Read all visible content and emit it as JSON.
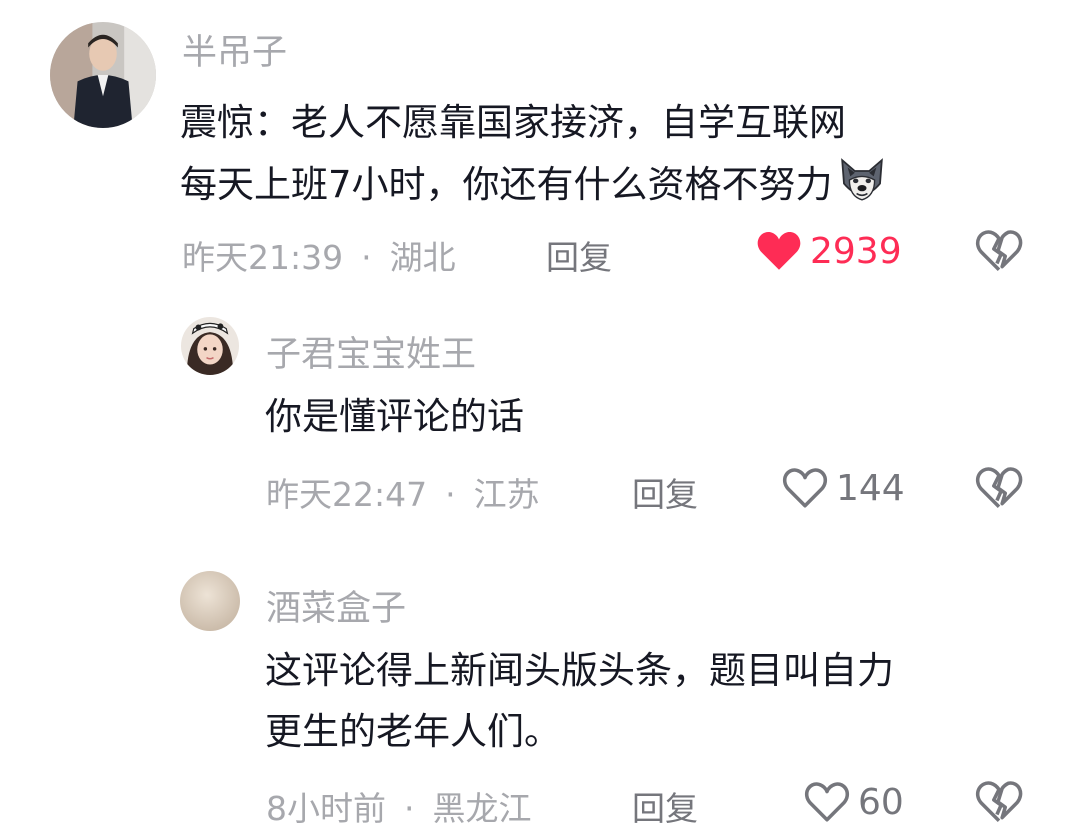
{
  "comments": [
    {
      "username": "半吊子",
      "text_lines": [
        "震惊：老人不愿靠国家接济，自学互联网",
        "每天上班7小时，你还有什么资格不努力"
      ],
      "emoji": "wolf-face-icon",
      "time": "昨天21:39",
      "separator": "·",
      "location": "湖北",
      "reply_label": "回复",
      "likes": "2939",
      "liked": true
    },
    {
      "username": "子君宝宝姓王",
      "text_lines": [
        "你是懂评论的话"
      ],
      "time": "昨天22:47",
      "separator": "·",
      "location": "江苏",
      "reply_label": "回复",
      "likes": "144",
      "liked": false
    },
    {
      "username": "酒菜盒子",
      "text_lines": [
        "这评论得上新闻头版头条，题目叫自力",
        "更生的老年人们。"
      ],
      "time": "8小时前",
      "separator": "·",
      "location": "黑龙江",
      "reply_label": "回复",
      "likes": "60",
      "liked": false
    }
  ],
  "colors": {
    "like_active": "#fe2c55",
    "meta_text": "#a7a8ad",
    "body_text": "#161823"
  }
}
